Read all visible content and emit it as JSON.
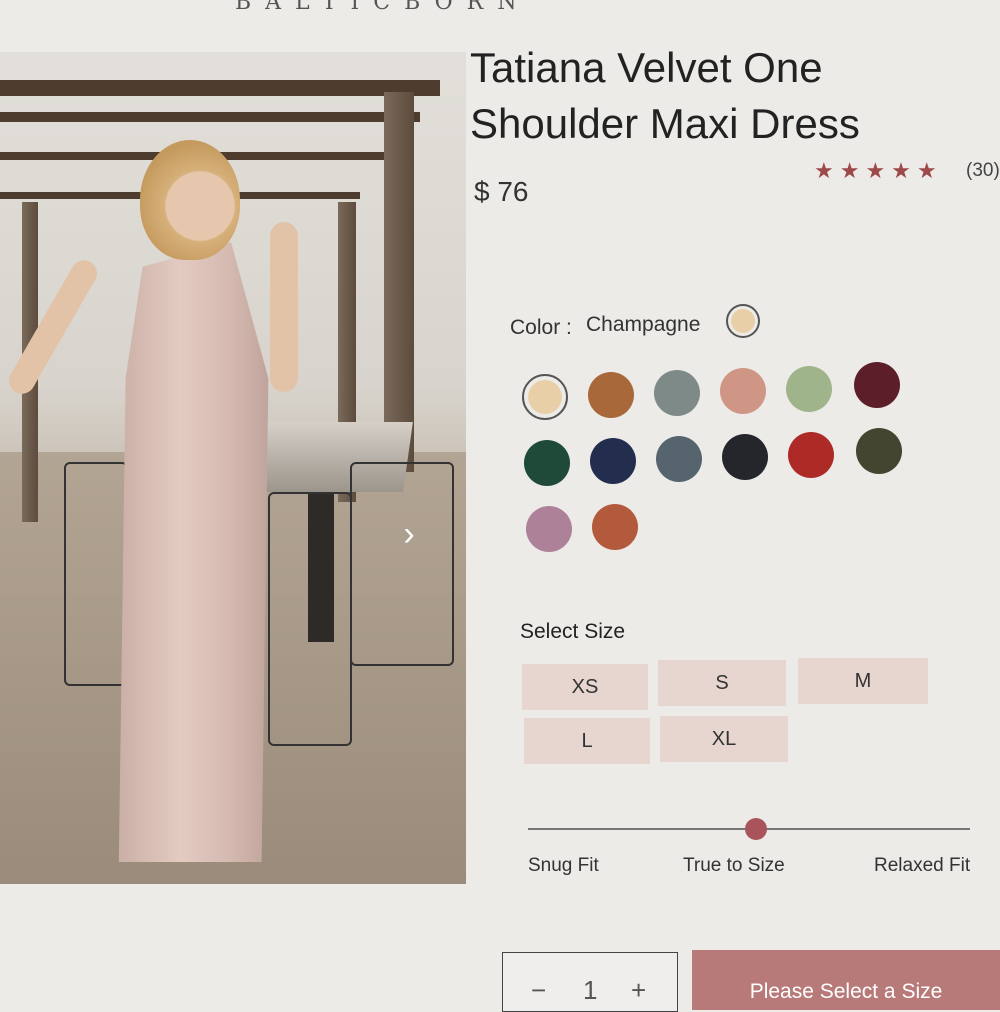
{
  "header": {
    "brand": "BALTICBORN"
  },
  "product": {
    "title_line1": "Tatiana Velvet One",
    "title_line2": "Shoulder Maxi Dress",
    "price": "$ 76",
    "stars": "★★★★★",
    "reviews": "(30)",
    "rating_stars": 5
  },
  "color": {
    "label": "Color :",
    "selected": "Champagne",
    "selected_hex": "#e9cfa8",
    "swatches": [
      {
        "name": "champagne",
        "hex": "#e9cfa8",
        "active": true
      },
      {
        "name": "rust-brown",
        "hex": "#a9683a"
      },
      {
        "name": "slate-grey",
        "hex": "#7d8a87"
      },
      {
        "name": "dusty-rose",
        "hex": "#cf9585"
      },
      {
        "name": "sage",
        "hex": "#9fb48a"
      },
      {
        "name": "burgundy",
        "hex": "#5c1f2a"
      },
      {
        "name": "emerald",
        "hex": "#1f4a39"
      },
      {
        "name": "navy",
        "hex": "#232d4e"
      },
      {
        "name": "blue-grey",
        "hex": "#56656d"
      },
      {
        "name": "black",
        "hex": "#24262b"
      },
      {
        "name": "red",
        "hex": "#ad2a27"
      },
      {
        "name": "olive",
        "hex": "#434530"
      },
      {
        "name": "mauve",
        "hex": "#ad8298"
      },
      {
        "name": "terracotta",
        "hex": "#b35a3d"
      }
    ]
  },
  "size": {
    "label": "Select Size",
    "options": [
      "XS",
      "S",
      "M",
      "L",
      "XL"
    ]
  },
  "fit": {
    "left": "Snug Fit",
    "center": "True to Size",
    "right": "Relaxed Fit",
    "value": "True to Size"
  },
  "cart": {
    "minus": "−",
    "quantity": "1",
    "plus": "+",
    "button": "Please Select a Size"
  },
  "gallery": {
    "next_icon": "chevron-right-icon"
  },
  "colors": {
    "accent": "#b77a78",
    "star": "#9e4a4a",
    "size_bg": "#e6d6cf",
    "knob": "#a8545a"
  }
}
